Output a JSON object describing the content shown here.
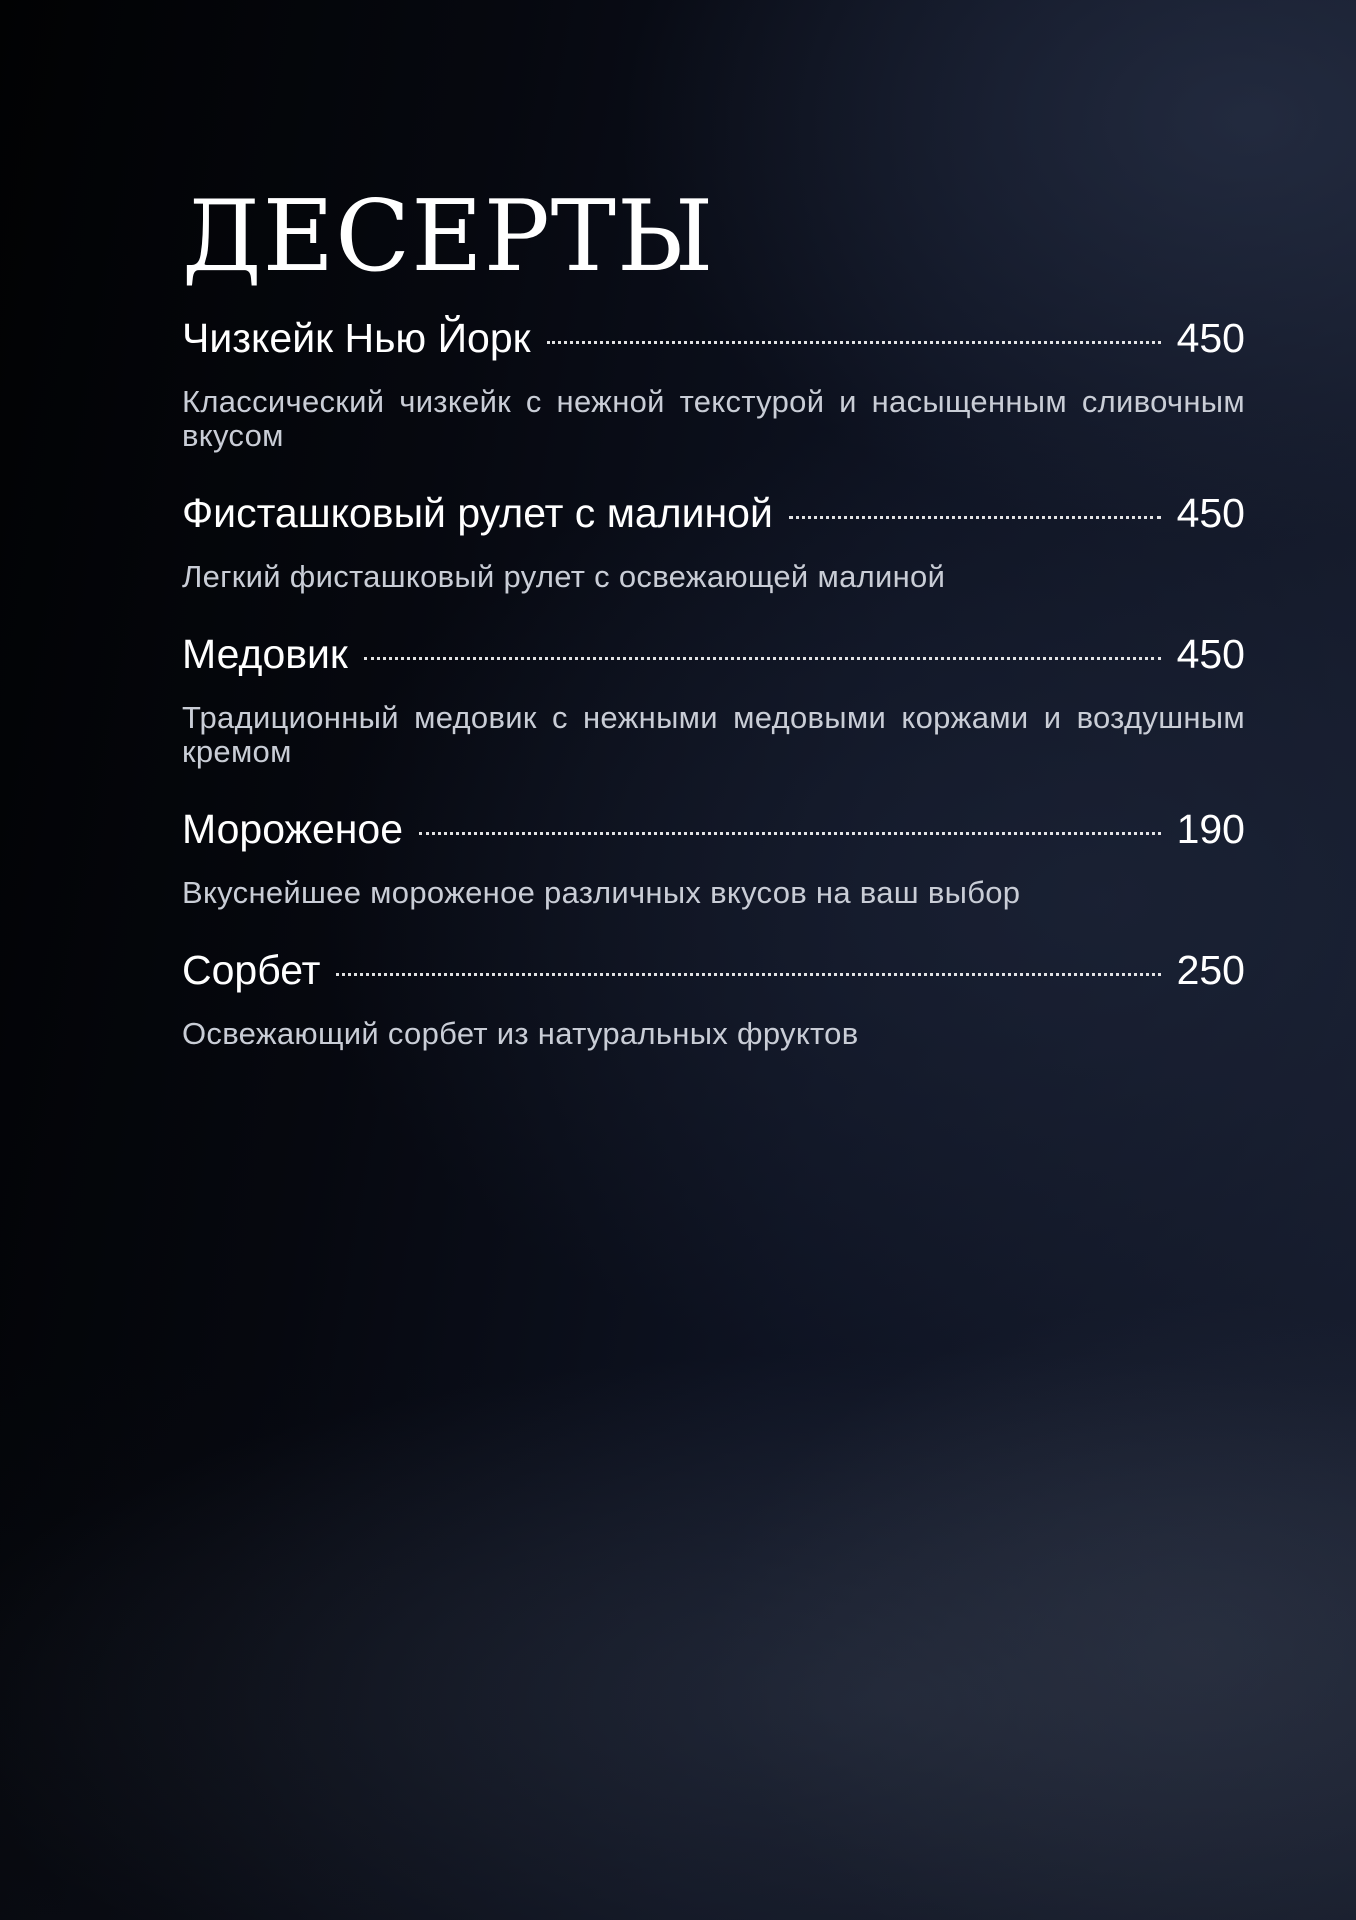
{
  "menu": {
    "title": "Десерты",
    "items": [
      {
        "name": "Чизкейк Нью Йорк",
        "price": "450",
        "description": "Классический чизкейк с нежной текстурой и насыщенным сливочным вкусом"
      },
      {
        "name": "Фисташковый рулет с малиной",
        "price": "450",
        "description": "Легкий фисташковый рулет с освежающей малиной"
      },
      {
        "name": "Медовик",
        "price": "450",
        "description": "Традиционный медовик с нежными медовыми коржами и воздушным кремом"
      },
      {
        "name": "Мороженое",
        "price": "190",
        "description": "Вкуснейшее мороженое различных вкусов на ваш выбор"
      },
      {
        "name": "Сорбет",
        "price": "250",
        "description": "Освежающий сорбет из натуральных фруктов"
      }
    ]
  }
}
